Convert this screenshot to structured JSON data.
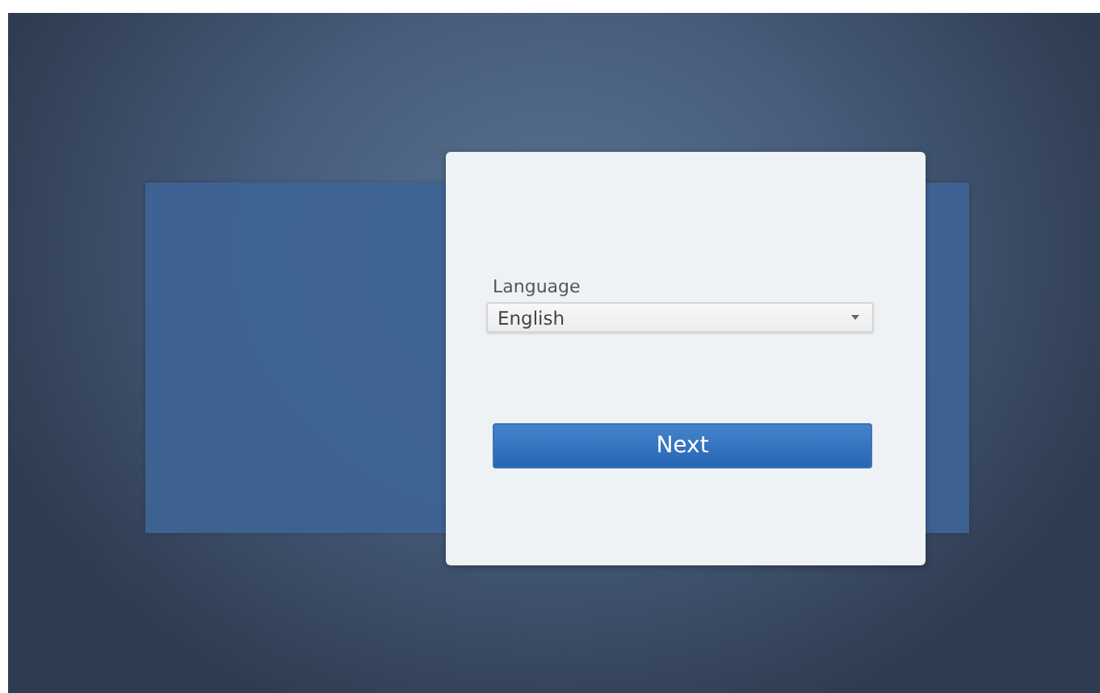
{
  "setup_form": {
    "language_label": "Language",
    "language_select": {
      "value": "English"
    },
    "next_button": "Next"
  }
}
